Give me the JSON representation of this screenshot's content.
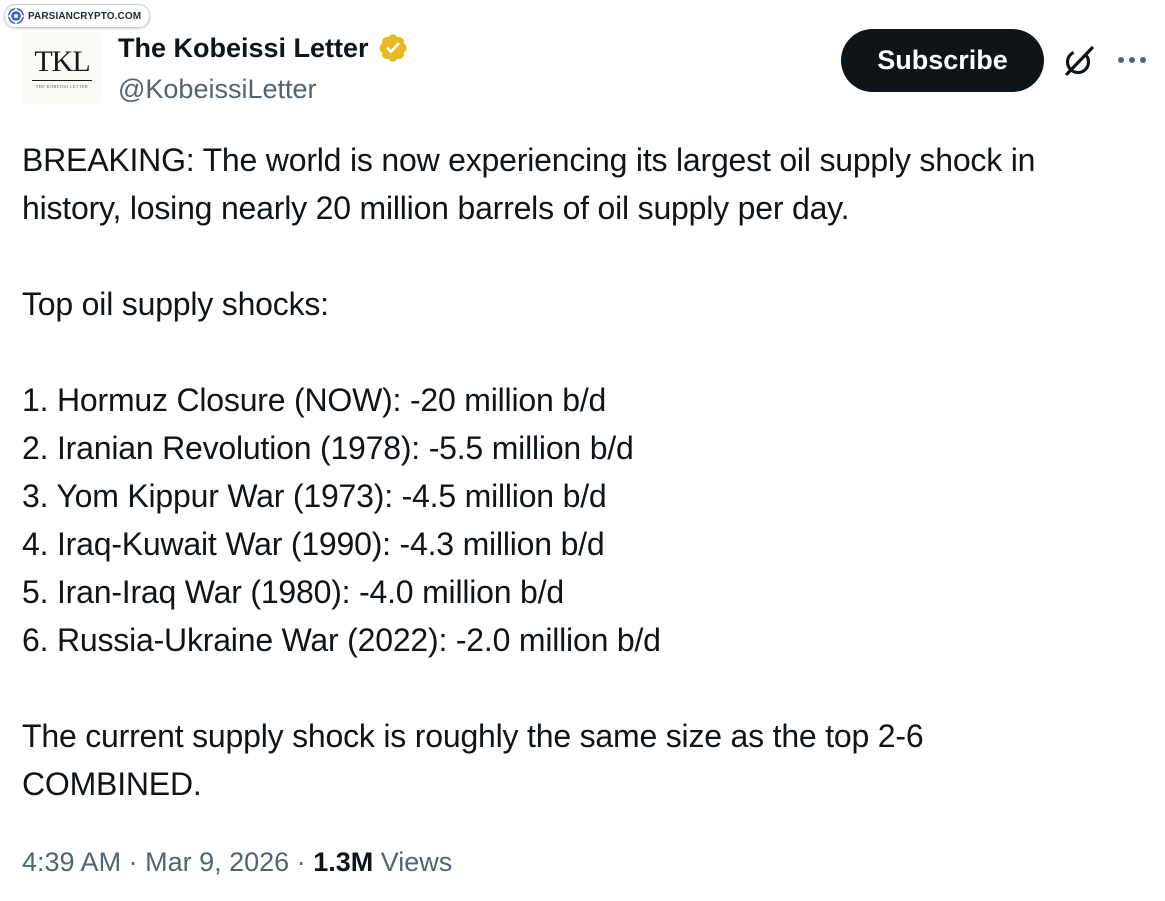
{
  "watermark": {
    "text": "PARSIANCRYPTO.COM",
    "logo_icon": "crypto-coin-icon"
  },
  "author": {
    "avatar_text": "TKL",
    "avatar_subtext": "THE KOBEISSI LETTER",
    "display_name": "The Kobeissi Letter",
    "handle": "@KobeissiLetter",
    "verified_icon": "gold-verified-badge-icon",
    "verified_color": "#e8b923"
  },
  "actions": {
    "subscribe_label": "Subscribe",
    "grok_icon": "grok-icon",
    "more_icon": "more-horizontal-icon"
  },
  "tweet": {
    "lines": [
      "BREAKING: The world is now experiencing its largest oil supply shock in",
      "history, losing nearly 20 million barrels of oil supply per day.",
      "",
      "Top oil supply shocks:",
      "",
      "1. Hormuz Closure (NOW): -20 million b/d",
      "2. Iranian Revolution (1978): -5.5 million b/d",
      "3. Yom Kippur War (1973): -4.5 million b/d",
      "4. Iraq-Kuwait War (1990): -4.3 million b/d",
      "5. Iran-Iraq War (1980): -4.0 million b/d",
      "6. Russia-Ukraine War (2022): -2.0 million b/d",
      "",
      "The current supply shock is roughly the same size as the top 2-6",
      "COMBINED."
    ]
  },
  "meta": {
    "time": "4:39 AM",
    "separator": "·",
    "date": "Mar 9, 2026",
    "views_count": "1.3M",
    "views_label": "Views"
  },
  "colors": {
    "text_primary": "#0f1419",
    "text_secondary": "#536471",
    "button_bg": "#0f1419",
    "button_text": "#ffffff"
  }
}
